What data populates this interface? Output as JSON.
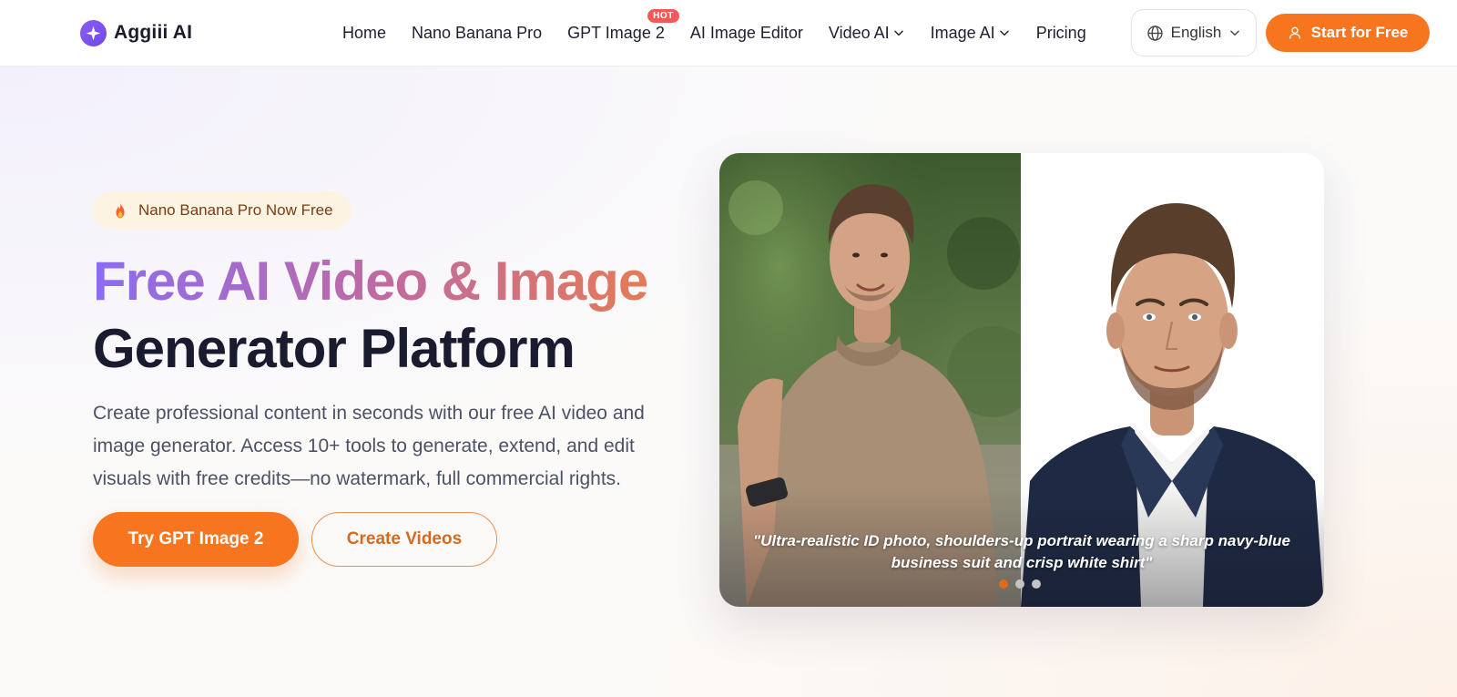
{
  "brand": {
    "name": "Aggiii AI"
  },
  "nav": {
    "items": [
      {
        "label": "Home"
      },
      {
        "label": "Nano Banana Pro"
      },
      {
        "label": "GPT Image 2",
        "badge": "HOT"
      },
      {
        "label": "AI Image Editor"
      },
      {
        "label": "Video AI"
      },
      {
        "label": "Image AI"
      },
      {
        "label": "Pricing"
      }
    ]
  },
  "language": {
    "selected": "English"
  },
  "header_cta": {
    "label": "Start for Free"
  },
  "hero": {
    "pill": "Nano Banana Pro Now Free",
    "title_line1": "Free AI Video & Image",
    "title_line2": "Generator Platform",
    "description": "Create professional content in seconds with our free AI video and image generator. Access 10+ tools to generate, extend, and edit visuals with free credits—no watermark, full commercial rights.",
    "primary_button": "Try GPT Image 2",
    "secondary_button": "Create Videos"
  },
  "showcase": {
    "caption": "\"Ultra-realistic ID photo, shoulders-up portrait wearing a sharp navy-blue business suit and crisp white shirt\"",
    "slides_count": 3,
    "active_slide": 1
  },
  "colors": {
    "accent": "#f7751f",
    "brand_purple": "#7c5cf0",
    "badge_red": "#f25a5a"
  },
  "icons": [
    "sparkle-icon",
    "chevron-down-icon",
    "globe-icon",
    "user-icon",
    "fire-icon"
  ]
}
